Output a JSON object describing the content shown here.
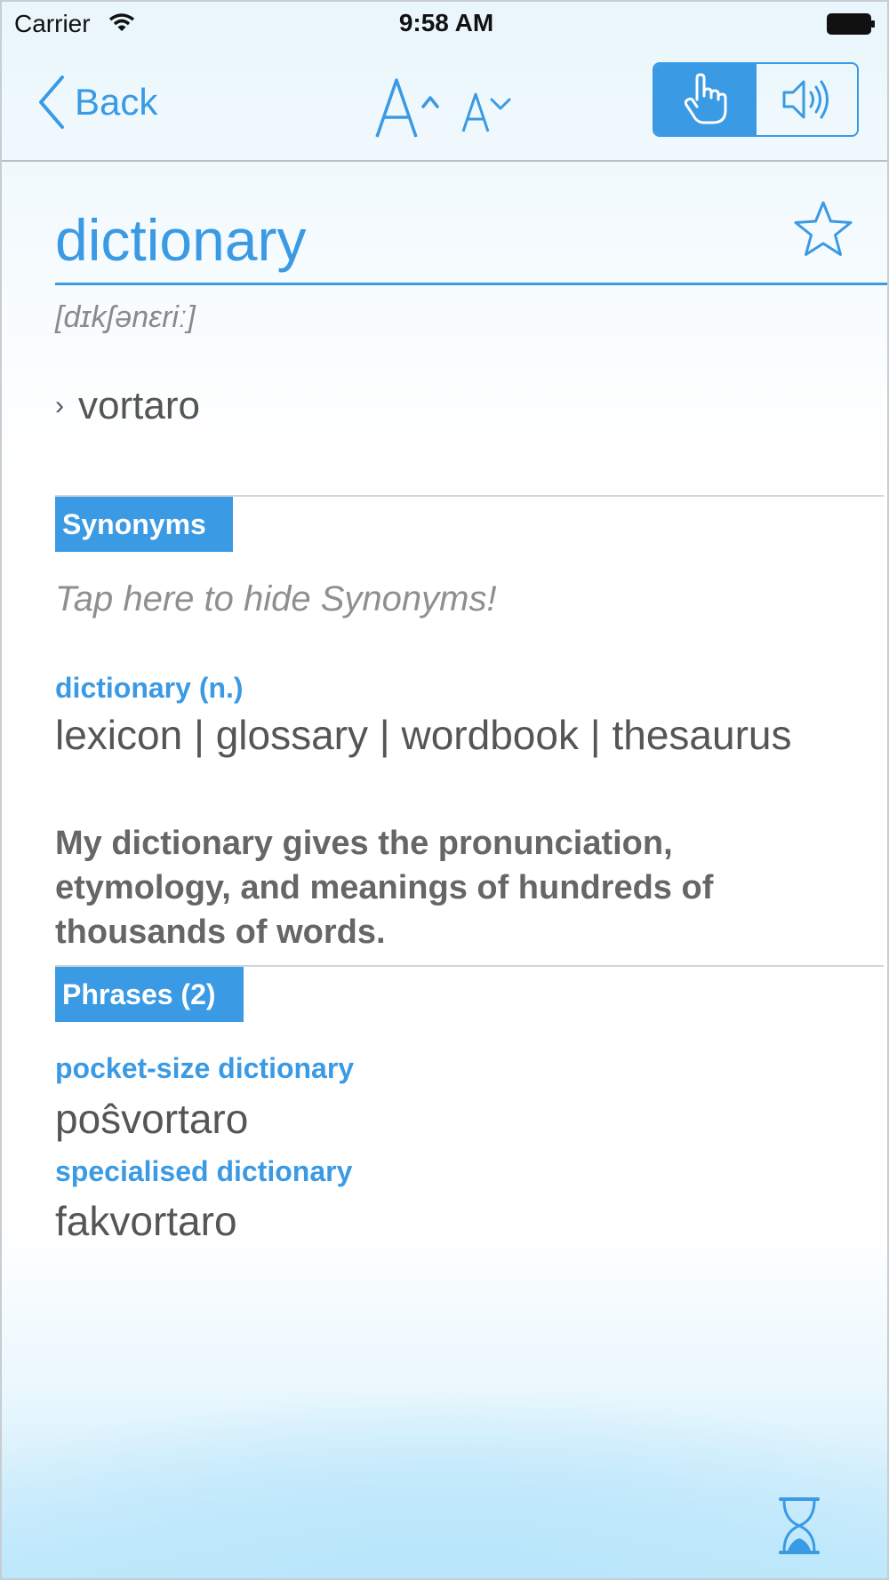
{
  "status_bar": {
    "carrier": "Carrier",
    "time": "9:58 AM"
  },
  "navbar": {
    "back_label": "Back",
    "font_up_icon": "font-size-increase-icon",
    "font_down_icon": "font-size-decrease-icon",
    "mode_segments": [
      {
        "icon": "hand-pointer-icon",
        "selected": true
      },
      {
        "icon": "speaker-icon",
        "selected": false
      }
    ]
  },
  "entry": {
    "word": "dictionary",
    "phonetic": "[dɪkʃənɛriː]",
    "translation_bullet": "›",
    "translation": "vortaro",
    "favorite_icon": "star-icon"
  },
  "synonyms": {
    "tab_label": "Synonyms",
    "hint": "Tap here to hide Synonyms!",
    "heading": "dictionary (n.)",
    "list": "lexicon | glossary | wordbook | thesaurus",
    "example": "My dictionary gives the pronunciation, etymology, and meanings of hundreds of thousands of words."
  },
  "phrases": {
    "tab_label": "Phrases (2)",
    "items": [
      {
        "phrase": "pocket-size dictionary",
        "translation": "poŝvortaro"
      },
      {
        "phrase": "specialised dictionary",
        "translation": "fakvortaro"
      }
    ]
  },
  "footer": {
    "icon": "hourglass-icon"
  },
  "colors": {
    "accent": "#3a9ae4",
    "text": "#555555",
    "hint": "#8f8f8f"
  }
}
